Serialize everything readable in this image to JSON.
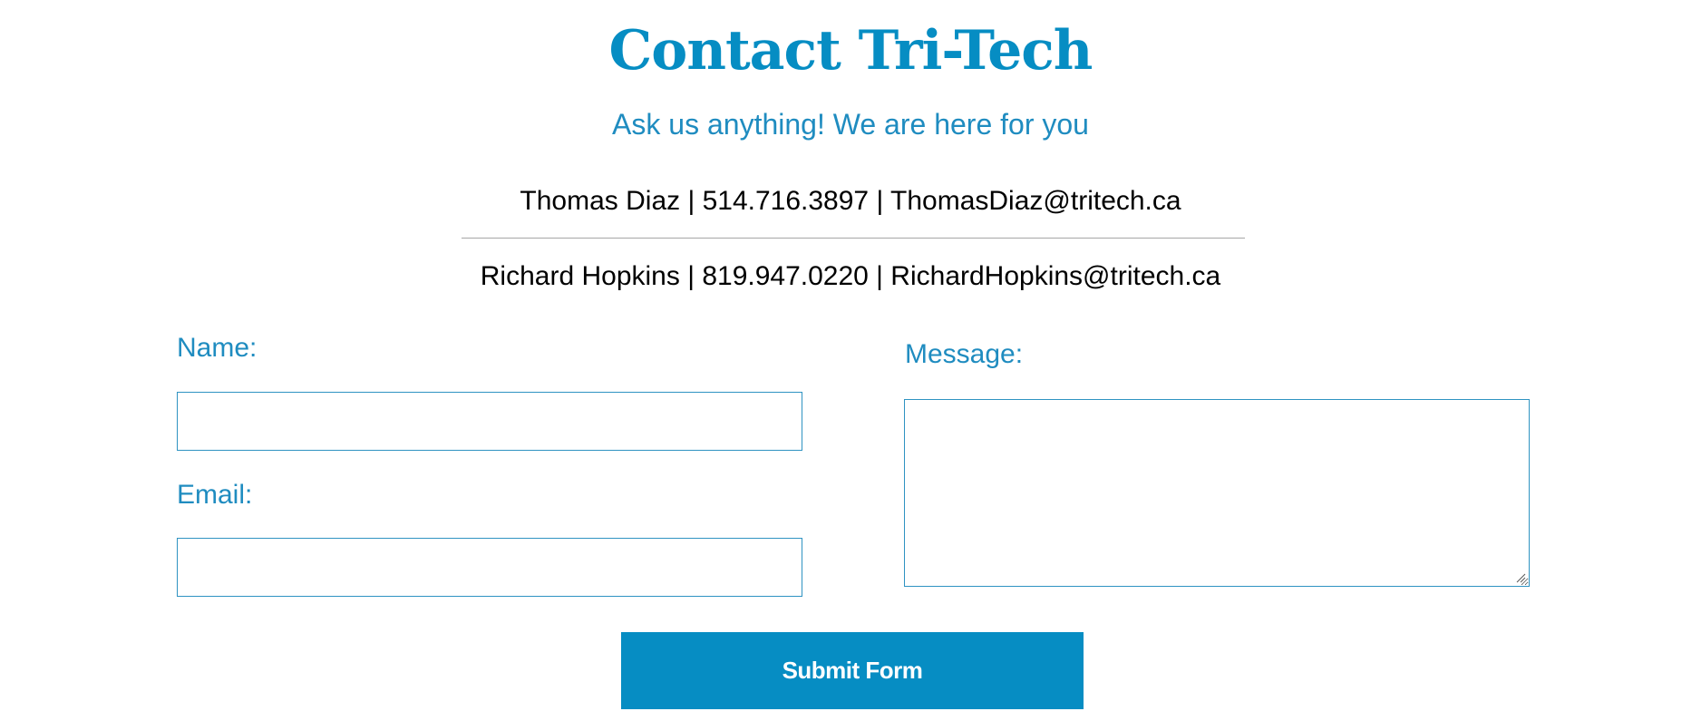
{
  "header": {
    "title": "Contact Tri-Tech",
    "subtitle": "Ask us anything! We are here for you"
  },
  "contacts": [
    {
      "line": "Thomas Diaz | 514.716.3897 | ThomasDiaz@tritech.ca"
    },
    {
      "line": "Richard Hopkins | 819.947.0220 | RichardHopkins@tritech.ca"
    }
  ],
  "form": {
    "name_label": "Name:",
    "name_value": "",
    "email_label": "Email:",
    "email_value": "",
    "message_label": "Message:",
    "message_value": "",
    "submit_label": "Submit Form"
  },
  "colors": {
    "accent": "#068dc3",
    "label": "#1f8cc0",
    "input_border": "#2f93c2",
    "divider": "#a7a7a7"
  },
  "icons": {
    "resize_grip": "resize-grip-icon"
  }
}
